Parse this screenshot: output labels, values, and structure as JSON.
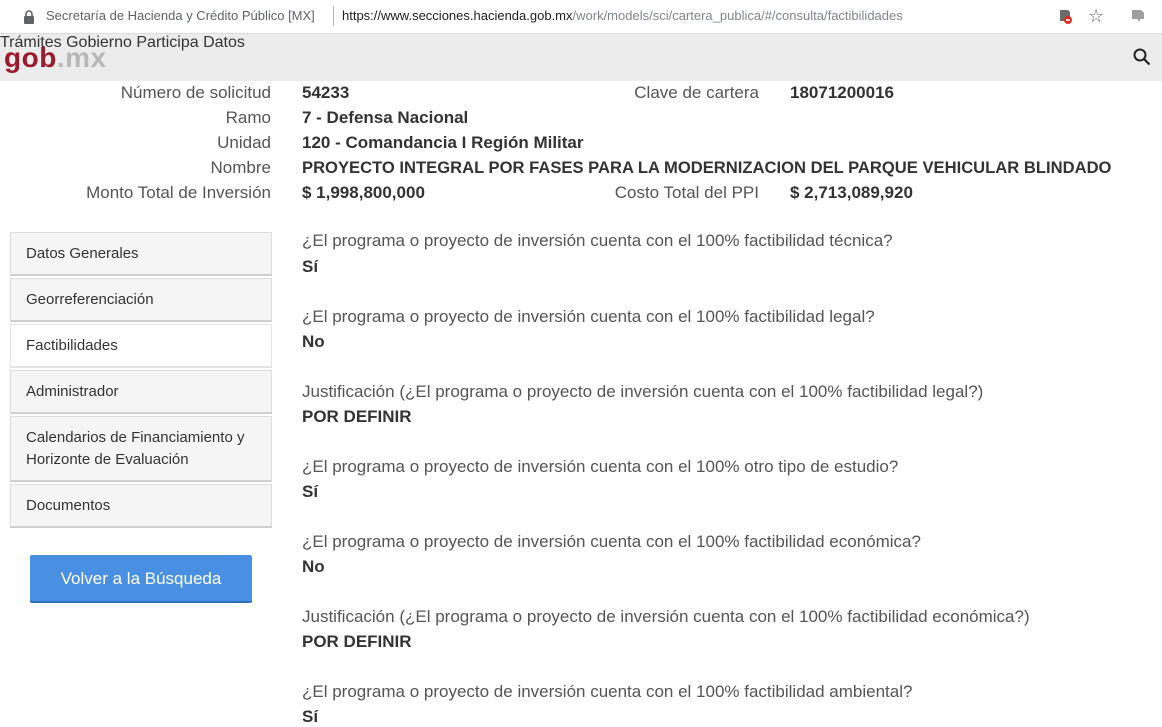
{
  "browser": {
    "site_name": "Secretaría de Hacienda y Crédito Público [MX]",
    "url_host": "https://www.secciones.hacienda.gob.mx",
    "url_path": "/work/models/sci/cartera_publica/#/consulta/factibilidades"
  },
  "header": {
    "logo_left": "gob",
    "logo_right": ".mx",
    "nav": [
      "Trámites",
      "Gobierno",
      "Participa",
      "Datos"
    ]
  },
  "summary": {
    "numero_label": "Número de solicitud",
    "numero_value": "54233",
    "clave_label": "Clave de cartera",
    "clave_value": "18071200016",
    "ramo_label": "Ramo",
    "ramo_value": "7 - Defensa Nacional",
    "unidad_label": "Unidad",
    "unidad_value": "120 - Comandancia I Región Militar",
    "nombre_label": "Nombre",
    "nombre_value": "PROYECTO INTEGRAL POR FASES PARA LA MODERNIZACION DEL PARQUE VEHICULAR BLINDADO",
    "monto_label": "Monto Total de Inversión",
    "monto_value": "$ 1,998,800,000",
    "costo_label": "Costo Total del PPI",
    "costo_value": "$ 2,713,089,920"
  },
  "sidebar": {
    "items": [
      {
        "label": "Datos Generales"
      },
      {
        "label": "Georreferenciación"
      },
      {
        "label": "Factibilidades"
      },
      {
        "label": "Administrador"
      },
      {
        "label": "Calendarios de Financiamiento y",
        "label2": "Horizonte de Evaluación"
      },
      {
        "label": "Documentos"
      }
    ],
    "active": "Factibilidades",
    "back_button": "Volver a la Búsqueda"
  },
  "factibilidades": [
    {
      "question": "¿El programa o proyecto de inversión cuenta con el 100% factibilidad técnica?",
      "answer": "Sí"
    },
    {
      "question": "¿El programa o proyecto de inversión cuenta con el 100% factibilidad legal?",
      "answer": "No"
    },
    {
      "question": "Justificación (¿El programa o proyecto de inversión cuenta con el 100% factibilidad legal?)",
      "answer": "POR DEFINIR"
    },
    {
      "question": "¿El programa o proyecto de inversión cuenta con el 100% otro tipo de estudio?",
      "answer": "Sí"
    },
    {
      "question": "¿El programa o proyecto de inversión cuenta con el 100% factibilidad económica?",
      "answer": "No"
    },
    {
      "question": "Justificación (¿El programa o proyecto de inversión cuenta con el 100% factibilidad económica?)",
      "answer": "POR DEFINIR"
    },
    {
      "question": "¿El programa o proyecto de inversión cuenta con el 100% factibilidad ambiental?",
      "answer": "Sí"
    }
  ],
  "colors": {
    "brand": "#9b1a2f",
    "header_bg": "#ececec",
    "button": "#4a90e2"
  }
}
